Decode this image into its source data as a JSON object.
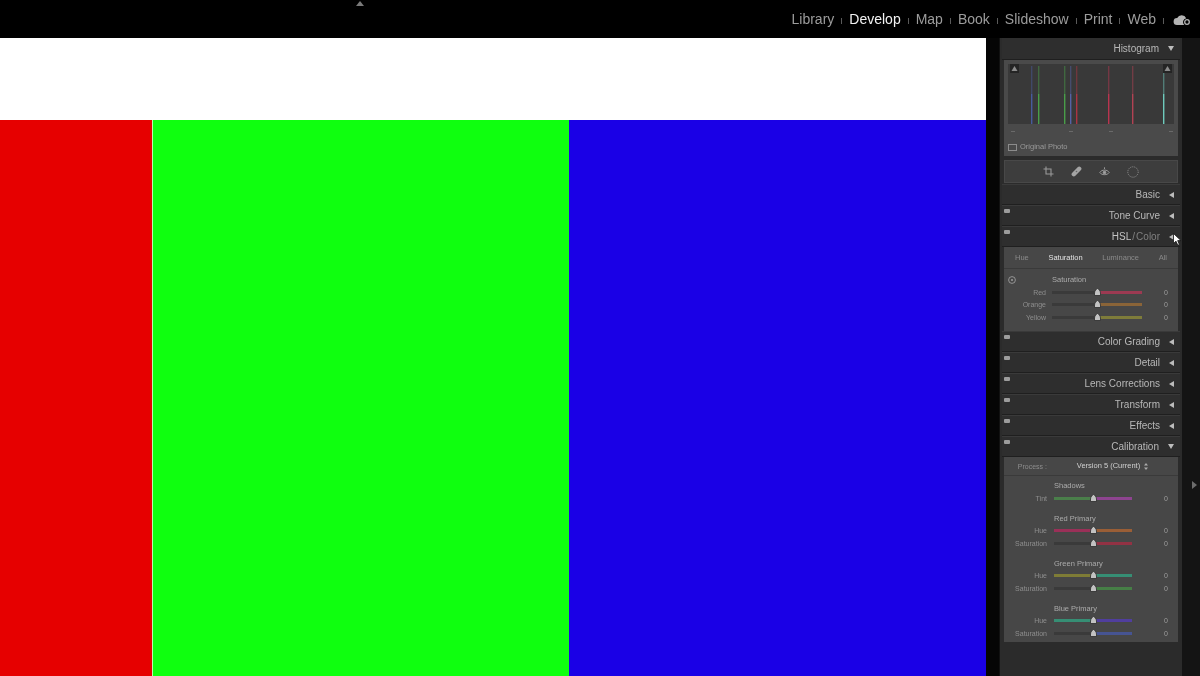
{
  "top_bar": {
    "modules": [
      {
        "label": "Library",
        "selected": false
      },
      {
        "label": "Develop",
        "selected": true
      },
      {
        "label": "Map",
        "selected": false
      },
      {
        "label": "Book",
        "selected": false
      },
      {
        "label": "Slideshow",
        "selected": false
      },
      {
        "label": "Print",
        "selected": false
      },
      {
        "label": "Web",
        "selected": false
      }
    ]
  },
  "right_panel": {
    "histogram": {
      "title": "Histogram",
      "expanded": true,
      "original_photo": {
        "label": "Original Photo",
        "checked": false
      }
    },
    "panels": [
      {
        "kind": "plain",
        "title": "Basic",
        "switch": false,
        "expanded": false
      },
      {
        "kind": "plain",
        "title": "Tone Curve",
        "switch": true,
        "expanded": false
      },
      {
        "kind": "hsl",
        "title_parts": [
          {
            "label": "HSL",
            "selected": true
          },
          {
            "label": "Color",
            "selected": false
          }
        ],
        "separator": "/",
        "switch": true,
        "expanded": false,
        "tabs": [
          {
            "label": "Hue",
            "selected": false
          },
          {
            "label": "Saturation",
            "selected": true
          },
          {
            "label": "Luminance",
            "selected": false
          },
          {
            "label": "All",
            "selected": false
          }
        ],
        "group": "Saturation",
        "sliders": [
          {
            "label": "Red",
            "value": "0",
            "level": 0.5,
            "stops": [
              {
                "color": "#3a3a3a"
              },
              {
                "color": "#9c3a52"
              }
            ]
          },
          {
            "label": "Orange",
            "value": "0",
            "level": 0.5,
            "stops": [
              {
                "color": "#3a3a3a"
              },
              {
                "color": "#8a6438"
              }
            ]
          },
          {
            "label": "Yellow",
            "value": "0",
            "level": 0.5,
            "stops": [
              {
                "color": "#3a3a3a"
              },
              {
                "color": "#7e7c3a"
              }
            ]
          }
        ]
      },
      {
        "kind": "plain",
        "title": "Color Grading",
        "switch": true,
        "expanded": false
      },
      {
        "kind": "plain",
        "title": "Detail",
        "switch": true,
        "expanded": false
      },
      {
        "kind": "plain",
        "title": "Lens Corrections",
        "switch": true,
        "expanded": false
      },
      {
        "kind": "plain",
        "title": "Transform",
        "switch": true,
        "expanded": false
      },
      {
        "kind": "plain",
        "title": "Effects",
        "switch": true,
        "expanded": false
      },
      {
        "kind": "calibration",
        "title": "Calibration",
        "switch": true,
        "expanded": true,
        "process": {
          "label": "Process :",
          "value": "Version 5 (Current)"
        },
        "groups": [
          {
            "title": "Shadows",
            "sliders": [
              {
                "label": "Tint",
                "value": "0",
                "level": 0.5,
                "stops": [
                  {
                    "color": "#4a7e4a"
                  },
                  {
                    "color": "#8e4490"
                  }
                ]
              }
            ]
          },
          {
            "title": "Red Primary",
            "sliders": [
              {
                "label": "Hue",
                "value": "0",
                "level": 0.5,
                "stops": [
                  {
                    "color": "#9a3058"
                  },
                  {
                    "color": "#9a5e36"
                  }
                ]
              },
              {
                "label": "Saturation",
                "value": "0",
                "level": 0.5,
                "stops": [
                  {
                    "color": "#3a3a3a"
                  },
                  {
                    "color": "#923244"
                  }
                ]
              }
            ]
          },
          {
            "title": "Green Primary",
            "sliders": [
              {
                "label": "Hue",
                "value": "0",
                "level": 0.5,
                "stops": [
                  {
                    "color": "#7e7c36"
                  },
                  {
                    "color": "#368e74"
                  }
                ]
              },
              {
                "label": "Saturation",
                "value": "0",
                "level": 0.5,
                "stops": [
                  {
                    "color": "#3a3a3a"
                  },
                  {
                    "color": "#467e46"
                  }
                ]
              }
            ]
          },
          {
            "title": "Blue Primary",
            "sliders": [
              {
                "label": "Hue",
                "value": "0",
                "level": 0.5,
                "stops": [
                  {
                    "color": "#368e74"
                  },
                  {
                    "color": "#503e9e"
                  }
                ]
              },
              {
                "label": "Saturation",
                "value": "0",
                "level": 0.5,
                "stops": [
                  {
                    "color": "#3a3a3a"
                  },
                  {
                    "color": "#465492"
                  }
                ]
              }
            ]
          }
        ]
      }
    ]
  }
}
